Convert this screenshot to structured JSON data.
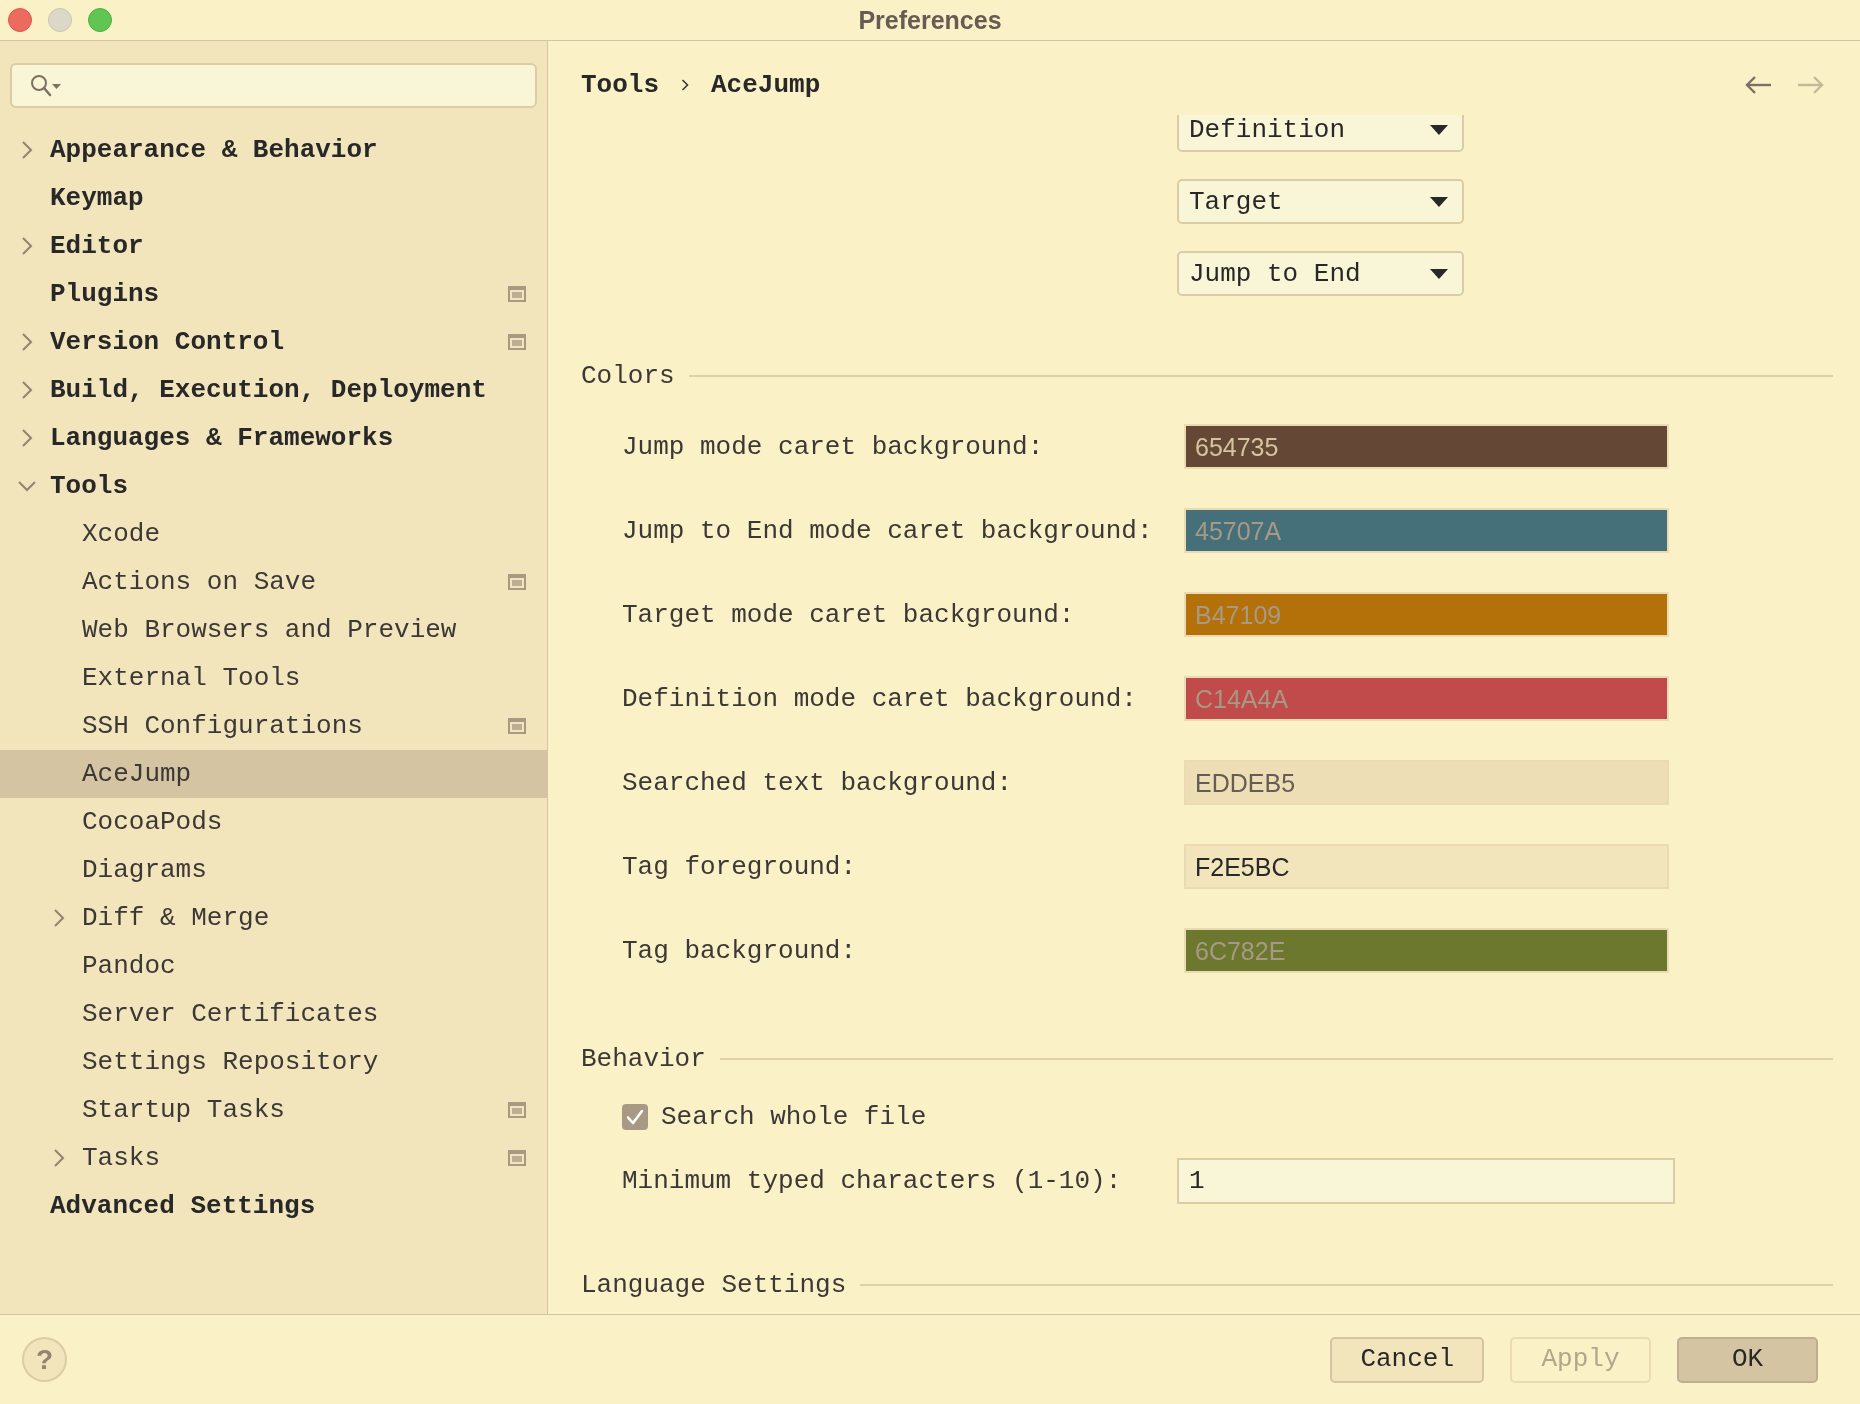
{
  "window": {
    "title": "Preferences"
  },
  "sidebar": {
    "items": [
      {
        "label": "Appearance & Behavior",
        "expandable": true,
        "expanded": false,
        "badge": false,
        "selected": false
      },
      {
        "label": "Keymap",
        "expandable": false,
        "expanded": false,
        "badge": false,
        "selected": false
      },
      {
        "label": "Editor",
        "expandable": true,
        "expanded": false,
        "badge": false,
        "selected": false
      },
      {
        "label": "Plugins",
        "expandable": false,
        "expanded": false,
        "badge": true,
        "selected": false
      },
      {
        "label": "Version Control",
        "expandable": true,
        "expanded": false,
        "badge": true,
        "selected": false
      },
      {
        "label": "Build, Execution, Deployment",
        "expandable": true,
        "expanded": false,
        "badge": false,
        "selected": false
      },
      {
        "label": "Languages & Frameworks",
        "expandable": true,
        "expanded": false,
        "badge": false,
        "selected": false
      },
      {
        "label": "Tools",
        "expandable": true,
        "expanded": true,
        "badge": false,
        "selected": false,
        "children": [
          {
            "label": "Xcode",
            "expandable": false,
            "expanded": false,
            "badge": false,
            "selected": false
          },
          {
            "label": "Actions on Save",
            "expandable": false,
            "expanded": false,
            "badge": true,
            "selected": false
          },
          {
            "label": "Web Browsers and Preview",
            "expandable": false,
            "expanded": false,
            "badge": false,
            "selected": false
          },
          {
            "label": "External Tools",
            "expandable": false,
            "expanded": false,
            "badge": false,
            "selected": false
          },
          {
            "label": "SSH Configurations",
            "expandable": false,
            "expanded": false,
            "badge": true,
            "selected": false
          },
          {
            "label": "AceJump",
            "expandable": false,
            "expanded": false,
            "badge": false,
            "selected": true
          },
          {
            "label": "CocoaPods",
            "expandable": false,
            "expanded": false,
            "badge": false,
            "selected": false
          },
          {
            "label": "Diagrams",
            "expandable": false,
            "expanded": false,
            "badge": false,
            "selected": false
          },
          {
            "label": "Diff & Merge",
            "expandable": true,
            "expanded": false,
            "badge": false,
            "selected": false
          },
          {
            "label": "Pandoc",
            "expandable": false,
            "expanded": false,
            "badge": false,
            "selected": false
          },
          {
            "label": "Server Certificates",
            "expandable": false,
            "expanded": false,
            "badge": false,
            "selected": false
          },
          {
            "label": "Settings Repository",
            "expandable": false,
            "expanded": false,
            "badge": false,
            "selected": false
          },
          {
            "label": "Startup Tasks",
            "expandable": false,
            "expanded": false,
            "badge": true,
            "selected": false
          },
          {
            "label": "Tasks",
            "expandable": true,
            "expanded": false,
            "badge": true,
            "selected": false
          }
        ]
      },
      {
        "label": "Advanced Settings",
        "expandable": false,
        "expanded": false,
        "badge": false,
        "selected": false
      }
    ]
  },
  "breadcrumb": [
    "Tools",
    "AceJump"
  ],
  "navigation": {
    "back": {
      "disabled": false
    },
    "forward": {
      "disabled": true
    }
  },
  "dropdowns": [
    {
      "value": "Definition"
    },
    {
      "value": "Target"
    },
    {
      "value": "Jump to End"
    }
  ],
  "colors": {
    "title": "Colors",
    "rows": [
      {
        "label": "Jump mode caret background:",
        "value": "654735",
        "color": "#654735"
      },
      {
        "label": "Jump to End mode caret background:",
        "value": "45707A",
        "color": "#45707a"
      },
      {
        "label": "Target mode caret background:",
        "value": "B47109",
        "color": "#b47109"
      },
      {
        "label": "Definition mode caret background:",
        "value": "C14A4A",
        "color": "#c14a4a"
      },
      {
        "label": "Searched text background:",
        "value": "EDDEB5",
        "color": "#eddeb5"
      },
      {
        "label": "Tag foreground:",
        "value": "F2E5BC",
        "color": "#f2e5bc"
      },
      {
        "label": "Tag background:",
        "value": "6C782E",
        "color": "#6c782e"
      }
    ]
  },
  "behavior": {
    "title": "Behavior",
    "checkbox": {
      "label": "Search whole file",
      "checked": true
    },
    "min_chars": {
      "label": "Minimum typed characters (1-10):",
      "value": "1"
    }
  },
  "language_settings": {
    "title": "Language Settings"
  },
  "help_button": {
    "label": "?"
  },
  "buttons": [
    {
      "label": "Cancel",
      "disabled": false,
      "default": false
    },
    {
      "label": "Apply",
      "disabled": true,
      "default": false
    },
    {
      "label": "OK",
      "disabled": false,
      "default": true
    }
  ]
}
